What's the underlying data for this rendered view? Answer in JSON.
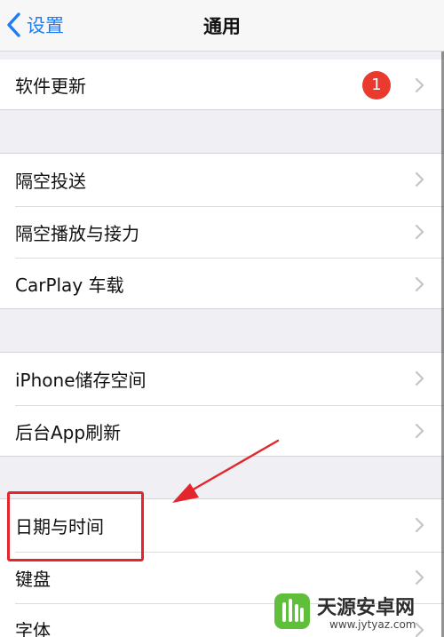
{
  "navbar": {
    "back_label": "设置",
    "title": "通用"
  },
  "groups": [
    {
      "items": [
        {
          "label": "软件更新",
          "badge": "1"
        }
      ]
    },
    {
      "items": [
        {
          "label": "隔空投送"
        },
        {
          "label": "隔空播放与接力"
        },
        {
          "label": "CarPlay 车载"
        }
      ]
    },
    {
      "items": [
        {
          "label": "iPhone储存空间"
        },
        {
          "label": "后台App刷新"
        }
      ]
    },
    {
      "items": [
        {
          "label": "日期与时间"
        },
        {
          "label": "键盘"
        },
        {
          "label": "字体"
        }
      ]
    }
  ],
  "colors": {
    "accent": "#1f7cf5",
    "badge": "#ea3a2e",
    "annotation": "#e3262b",
    "background": "#efeff4"
  },
  "icons": {
    "back": "chevron-left-icon",
    "disclosure": "chevron-right-icon"
  },
  "watermark": {
    "title": "天源安卓网",
    "subtitle": "www.jytyaz.com"
  }
}
